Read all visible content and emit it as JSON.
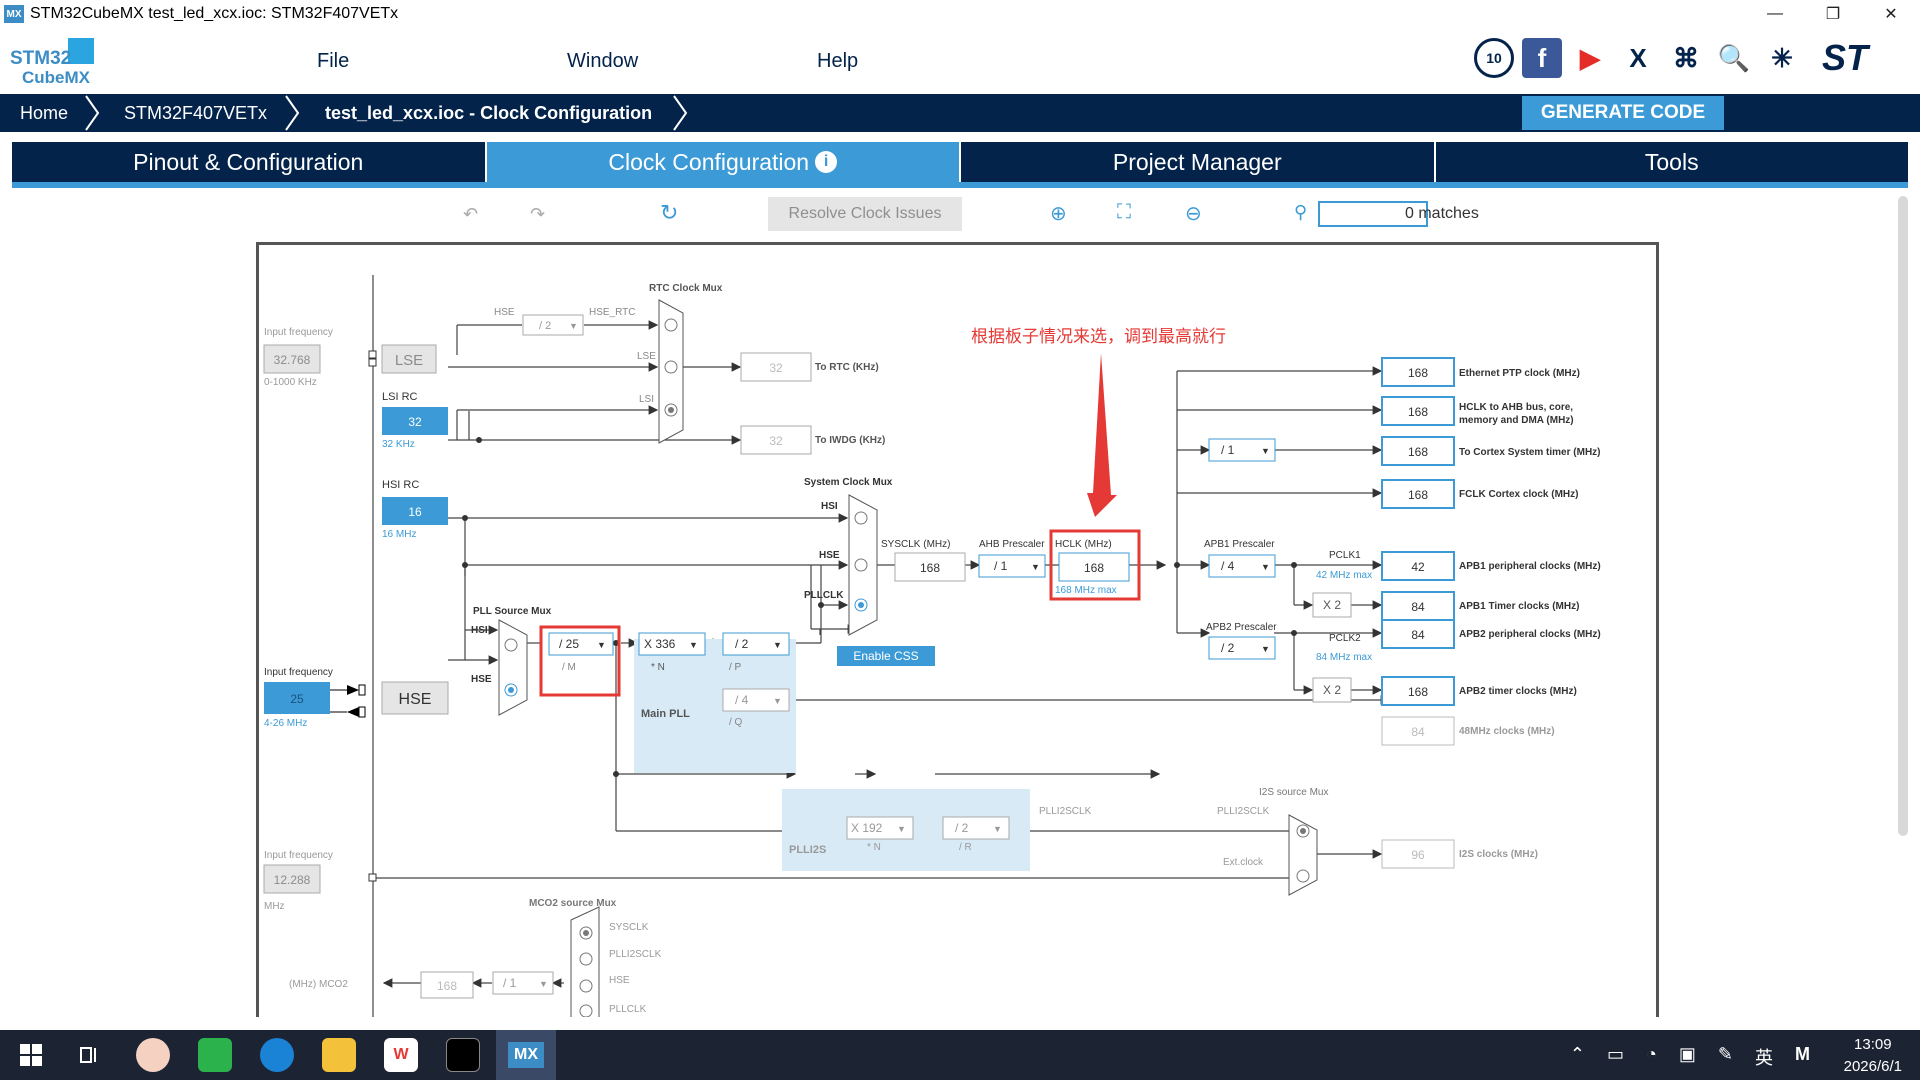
{
  "window": {
    "title": "STM32CubeMX test_led_xcx.ioc: STM32F407VETx",
    "app_icon": "MX",
    "min": "—",
    "max": "❐",
    "close": "✕"
  },
  "logo": {
    "line1": "STM32",
    "line2": "CubeMX"
  },
  "menu": {
    "file": "File",
    "window": "Window",
    "help": "Help"
  },
  "social": [
    "10",
    "f",
    "▶",
    "X",
    "⌘",
    "🔍",
    "✳",
    "ST"
  ],
  "breadcrumb": {
    "home": "Home",
    "mcu": "STM32F407VETx",
    "current": "test_led_xcx.ioc - Clock Configuration"
  },
  "generate": "GENERATE CODE",
  "tabs": {
    "pinout": "Pinout & Configuration",
    "clock": "Clock Configuration",
    "project": "Project Manager",
    "tools": "Tools",
    "info": "i"
  },
  "toolbar": {
    "resolve": "Resolve Clock Issues",
    "matches": "0 matches",
    "undo": "↶",
    "redo": "↷",
    "refresh": "↻",
    "zoom_in": "⊕",
    "fit": "⛶",
    "zoom_out": "⊖",
    "search": "⚲"
  },
  "diagram": {
    "annotation": "根据板子情况来选，调到最高就行",
    "input_freq_label": "Input frequency",
    "lse_freq": "32.768",
    "lse_range": "0-1000 KHz",
    "lse": "LSE",
    "lsi_label": "LSI RC",
    "lsi_val": "32",
    "lsi_unit": "32 KHz",
    "hsi_label": "HSI RC",
    "hsi_val": "16",
    "hsi_unit": "16 MHz",
    "hse_freq": "25",
    "hse_range": "4-26 MHz",
    "hse": "HSE",
    "i2s_in_label": "Input frequency",
    "i2s_in": "12.288",
    "i2s_in_unit": "MHz",
    "rtc_mux": "RTC Clock Mux",
    "hse_div": "/ 2",
    "hse_label": "HSE",
    "hse_rtc": "HSE_RTC",
    "lse_label": "LSE",
    "lsi_label2": "LSI",
    "to_rtc_val": "32",
    "to_rtc": "To RTC (KHz)",
    "to_iwdg_val": "32",
    "to_iwdg": "To IWDG (KHz)",
    "sys_mux": "System Clock Mux",
    "hsi": "HSI",
    "hse2": "HSE",
    "pllclk": "PLLCLK",
    "sysclk_label": "SYSCLK (MHz)",
    "sysclk": "168",
    "ahb_label": "AHB Prescaler",
    "ahb": "/ 1",
    "hclk_label": "HCLK (MHz)",
    "hclk": "168",
    "hclk_max": "168 MHz max",
    "enable_css": "Enable CSS",
    "pll_src": "PLL Source Mux",
    "pll_hsi": "HSI",
    "pll_hse": "HSE",
    "m": "/ 25",
    "m_label": "/ M",
    "n": "X 336",
    "n_label": "* N",
    "p": "/ 2",
    "p_label": "/ P",
    "q": "/ 4",
    "q_label": "/ Q",
    "main_pll": "Main PLL",
    "apb1_label": "APB1 Prescaler",
    "apb1": "/ 4",
    "pclk1": "PCLK1",
    "pclk1_max": "42 MHz max",
    "apb2_label": "APB2 Prescaler",
    "apb2": "/ 2",
    "pclk2": "PCLK2",
    "pclk2_max": "84 MHz max",
    "cortex_div": "/ 1",
    "x2a": "X 2",
    "x2b": "X 2",
    "outputs": [
      {
        "val": "168",
        "label": "Ethernet PTP clock (MHz)"
      },
      {
        "val": "168",
        "label": "HCLK to AHB bus, core,",
        "label2": "memory and DMA (MHz)"
      },
      {
        "val": "168",
        "label": "To Cortex System timer (MHz)"
      },
      {
        "val": "168",
        "label": "FCLK Cortex clock (MHz)"
      },
      {
        "val": "42",
        "label": "APB1 peripheral clocks (MHz)"
      },
      {
        "val": "84",
        "label": "APB1 Timer clocks (MHz)"
      },
      {
        "val": "84",
        "label": "APB2 peripheral clocks (MHz)"
      },
      {
        "val": "168",
        "label": "APB2 timer clocks (MHz)"
      },
      {
        "val": "84",
        "label": "48MHz clocks (MHz)"
      }
    ],
    "plli2s_n": "X 192",
    "plli2s_n_label": "* N",
    "plli2s_r": "/ 2",
    "plli2s_r_label": "/ R",
    "plli2s": "PLLI2S",
    "plli2sclk": "PLLI2SCLK",
    "i2s_mux": "I2S source Mux",
    "i2s_plli2sclk": "PLLI2SCLK",
    "ext_clock": "Ext.clock",
    "i2s_val": "96",
    "i2s_label": "I2S clocks (MHz)",
    "mco2_mux": "MCO2 source Mux",
    "mco2_sysclk": "SYSCLK",
    "mco2_plli2s": "PLLI2SCLK",
    "mco2_hse": "HSE",
    "mco2_pll": "PLLCLK",
    "mco2_label": "(MHz) MCO2",
    "mco2_val": "168",
    "mco2_div": "/ 1"
  },
  "taskbar": {
    "time": "13:09",
    "date": "2026/6/1",
    "ime": "英",
    "m": "M"
  },
  "colors": {
    "navy": "#03234b",
    "accent": "#3c9bd6",
    "red": "#e53935"
  }
}
